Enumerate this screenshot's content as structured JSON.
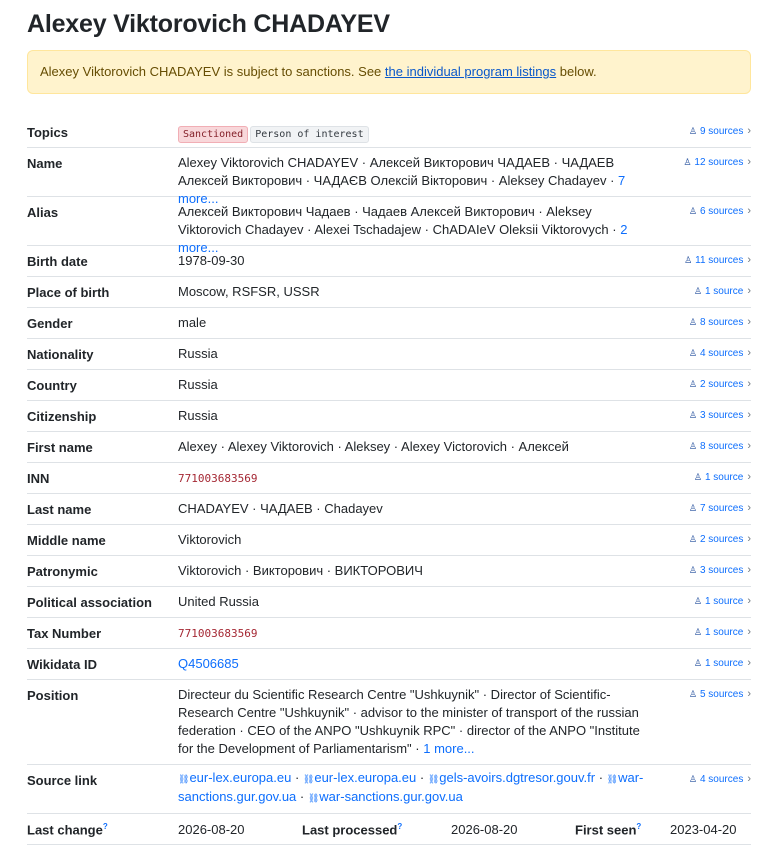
{
  "title": "Alexey Viktorovich CHADAYEV",
  "alert": {
    "prefix": "Alexey Viktorovich CHADAYEV is subject to sanctions. See ",
    "link": "the individual program listings",
    "suffix": " below."
  },
  "rows": [
    {
      "key": "Topics",
      "sources": "9 sources"
    },
    {
      "key": "Name",
      "value": "Alexey Viktorovich CHADAYEV · Алексей Викторович ЧАДАЕВ · ЧАДАЕВ Алексей Викторович · ЧАДАЄВ Олексій Вікторович · Aleksey Chadayev ·",
      "more": "7 more...",
      "sources": "12 sources"
    },
    {
      "key": "Alias",
      "value": "Алексей Викторович Чадаев · Чадаев Алексей Викторович · Aleksey Viktorovich Chadayev · Alexei Tschadajew · ChADAIeV Oleksii Viktorovych ·",
      "more": "2 more...",
      "sources": "6 sources"
    },
    {
      "key": "Birth date",
      "value": "1978-09-30",
      "sources": "11 sources"
    },
    {
      "key": "Place of birth",
      "value": "Moscow, RSFSR, USSR",
      "sources": "1 source"
    },
    {
      "key": "Gender",
      "value": "male",
      "sources": "8 sources"
    },
    {
      "key": "Nationality",
      "value": "Russia",
      "sources": "4 sources"
    },
    {
      "key": "Country",
      "value": "Russia",
      "sources": "2 sources"
    },
    {
      "key": "Citizenship",
      "value": "Russia",
      "sources": "3 sources"
    },
    {
      "key": "First name",
      "value": "Alexey · Alexey Viktorovich · Aleksey · Alexey Victorovich · Алексей",
      "sources": "8 sources"
    },
    {
      "key": "INN",
      "value": "771003683569",
      "sources": "1 source"
    },
    {
      "key": "Last name",
      "value": "CHADAYEV · ЧАДАЕВ · Chadayev",
      "sources": "7 sources"
    },
    {
      "key": "Middle name",
      "value": "Viktorovich",
      "sources": "2 sources"
    },
    {
      "key": "Patronymic",
      "value": "Viktorovich · Викторович · ВИКТОРОВИЧ",
      "sources": "3 sources"
    },
    {
      "key": "Political association",
      "value": "United Russia",
      "sources": "1 source"
    },
    {
      "key": "Tax Number",
      "value": "771003683569",
      "sources": "1 source"
    },
    {
      "key": "Wikidata ID",
      "value": "Q4506685",
      "sources": "1 source"
    },
    {
      "key": "Position",
      "value": "Directeur du Scientific Research Centre \"Ushkuynik\" · Director of Scientific-Research Centre \"Ushkuynik\" · advisor to the minister of transport of the russian federation · CEO of the ANPO \"Ushkuynik RPC\" · director of the ANPO \"Institute for the Development of Parliamentarism\" ·",
      "more": "1 more...",
      "sources": "5 sources"
    },
    {
      "key": "Source link",
      "sources": "4 sources"
    }
  ],
  "topics": [
    "Sanctioned",
    "Person of interest"
  ],
  "source_links": [
    "eur-lex.europa.eu",
    "eur-lex.europa.eu",
    "gels-avoirs.dgtresor.gouv.fr",
    "war-sanctions.gur.gov.ua",
    "war-sanctions.gur.gov.ua"
  ],
  "meta": {
    "last_change_label": "Last change",
    "last_change": "2026-08-20",
    "last_processed_label": "Last processed",
    "last_processed": "2026-08-20",
    "first_seen_label": "First seen",
    "first_seen": "2023-04-20",
    "info_mark": "?"
  },
  "icons": {
    "sources": "person-stack-icon",
    "chevron": "chevron-right-icon",
    "link": "link-icon"
  },
  "colors": {
    "accent": "#0d6efd",
    "alert_bg": "#fff3cd",
    "sanctioned_badge": "#f8d7da",
    "identifier": "#a52834"
  }
}
